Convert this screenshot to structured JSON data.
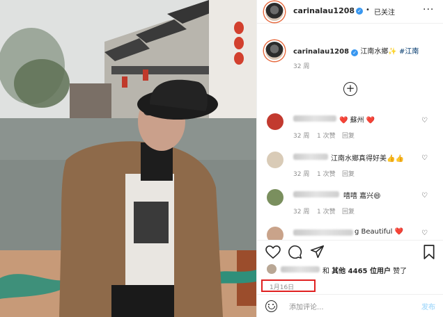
{
  "header": {
    "username": "carinalau1208",
    "verified_mark": "✓",
    "separator": "•",
    "follow_status": "已关注",
    "more": "···"
  },
  "caption": {
    "username": "carinalau1208",
    "text_prefix": "江南水鄉",
    "emoji": "✨",
    "hashtag": "#江南",
    "time": "32 周"
  },
  "load_more": "+",
  "comments": [
    {
      "text": "❤️ 蘇州 ❤️",
      "time": "32 周",
      "likes": "1 次赞",
      "reply": "回复",
      "avatar_color": "#c23a2f"
    },
    {
      "text": "江南水鄉真得好美👍👍",
      "time": "32 周",
      "likes": "1 次赞",
      "reply": "回复",
      "avatar_color": "#d9cbb7"
    },
    {
      "text": "嘻嘻 嘉兴😄",
      "time": "32 周",
      "likes": "1 次赞",
      "reply": "回复",
      "avatar_color": "#7a8f5e"
    },
    {
      "text": "g Beautiful ❤️",
      "time": "",
      "likes": "",
      "reply": "",
      "avatar_color": "#c9a38a"
    }
  ],
  "likes": {
    "and": "和",
    "others": "其他 4465 位用户",
    "liked": "赞了"
  },
  "date": "1月16日",
  "comment_bar": {
    "placeholder": "添加评论...",
    "post": "发布"
  },
  "colors": {
    "link": "#00376b",
    "highlight_box": "#e02020",
    "verified": "#3897f0"
  }
}
